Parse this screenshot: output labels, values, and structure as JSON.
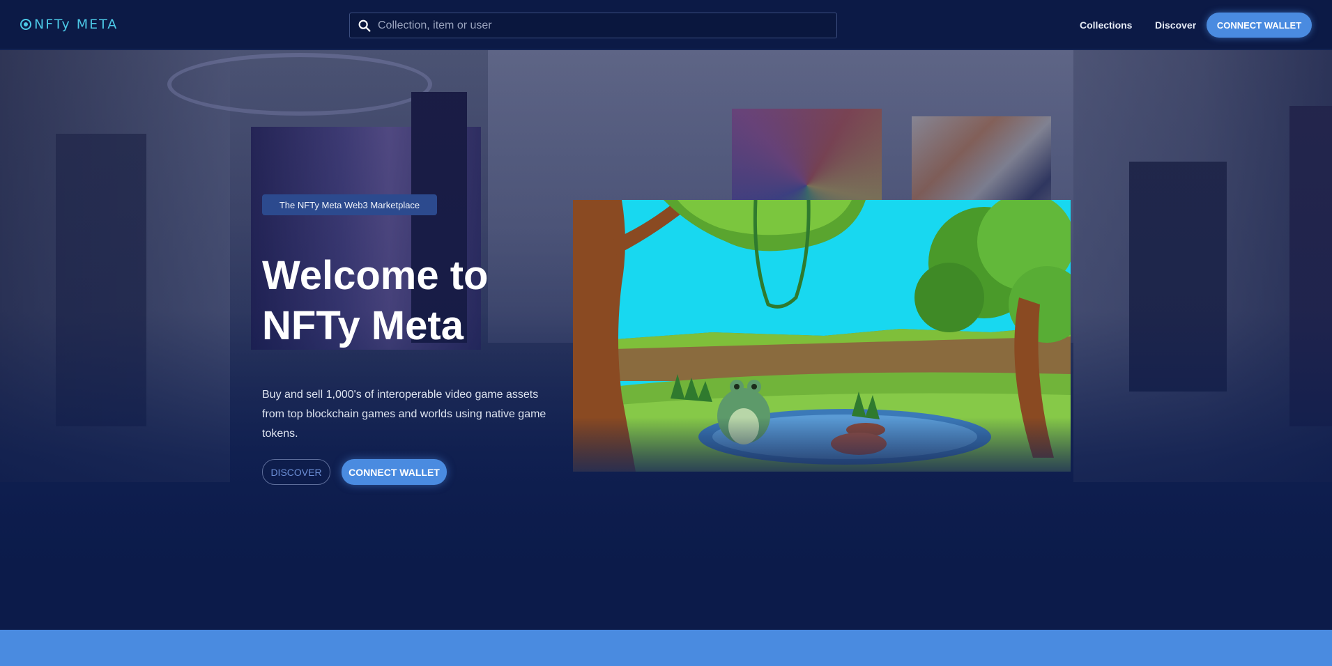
{
  "header": {
    "logo_text": "NFTy META",
    "search": {
      "placeholder": "Collection, item or user",
      "value": ""
    },
    "nav": [
      {
        "label": "Collections"
      },
      {
        "label": "Discover"
      }
    ],
    "connect_wallet_label": "CONNECT WALLET"
  },
  "hero": {
    "tag": "The NFTy Meta Web3 Marketplace",
    "title_line1": "Welcome to",
    "title_line2": "NFTy Meta",
    "subtitle": "Buy and sell 1,000's of interoperable video game assets from top blockchain games and worlds using native game tokens.",
    "discover_label": "DISCOVER",
    "connect_wallet_label": "CONNECT WALLET"
  },
  "colors": {
    "header_bg": "#0c1a46",
    "accent": "#4a8be0",
    "logo": "#4cc8e6",
    "tag_bg": "#2c4a8e"
  },
  "icons": {
    "search": "search-icon",
    "logo": "logo-icon"
  }
}
